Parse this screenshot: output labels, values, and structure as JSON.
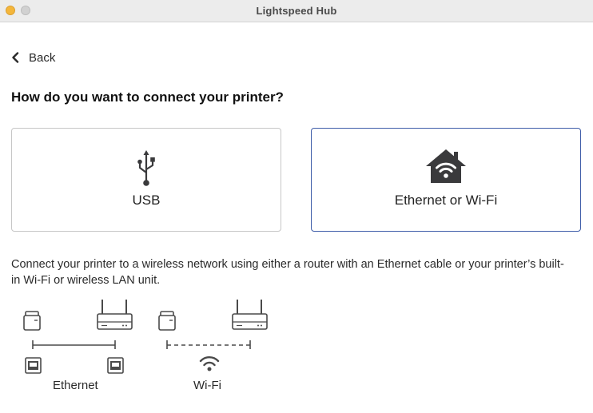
{
  "window": {
    "title": "Lightspeed Hub"
  },
  "nav": {
    "back_label": "Back"
  },
  "page": {
    "heading": "How do you want to connect your printer?"
  },
  "options": [
    {
      "label": "USB",
      "icon": "usb-icon",
      "selected": false
    },
    {
      "label": "Ethernet or Wi-Fi",
      "icon": "home-wifi-icon",
      "selected": true
    }
  ],
  "description": "Connect your printer to a wireless network using either a router with an Ethernet cable or your printer’s built-in Wi-Fi or wireless LAN unit.",
  "diagram": {
    "ethernet_label": "Ethernet",
    "wifi_label": "Wi-Fi"
  },
  "colors": {
    "selected_border": "#3d5ca8",
    "icon": "#3a3a3c",
    "titlebar": "#ececec"
  }
}
